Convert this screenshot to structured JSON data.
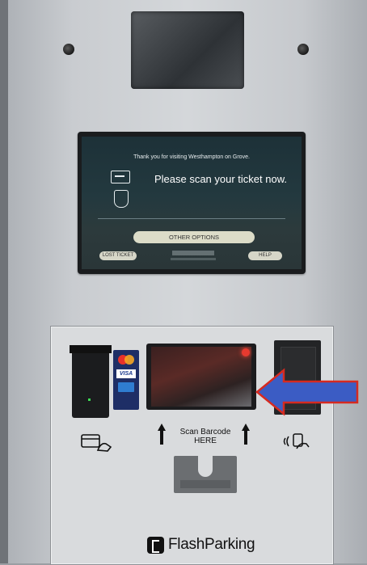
{
  "screen": {
    "thanks": "Thank you for visiting Westhampton on Grove.",
    "prompt": "Please scan your ticket now.",
    "other_options": "OTHER OPTIONS",
    "lost_ticket": "LOST TICKET",
    "help": "HELP"
  },
  "panel": {
    "scan_label": "Scan Barcode HERE",
    "card_brands": [
      "mastercard",
      "VISA",
      "amex"
    ],
    "brand": "FlashParking"
  },
  "icons": {
    "camera": "camera-window",
    "card": "card-insert-icon",
    "nfc": "tap-to-pay-icon",
    "arrow": "arrow-up-icon",
    "callout": "blue-arrow-icon"
  },
  "colors": {
    "callout_fill": "#3b5cc4",
    "callout_stroke": "#d62a20",
    "screen_bg": "#23393f",
    "button_bg": "#dcdcc8"
  }
}
